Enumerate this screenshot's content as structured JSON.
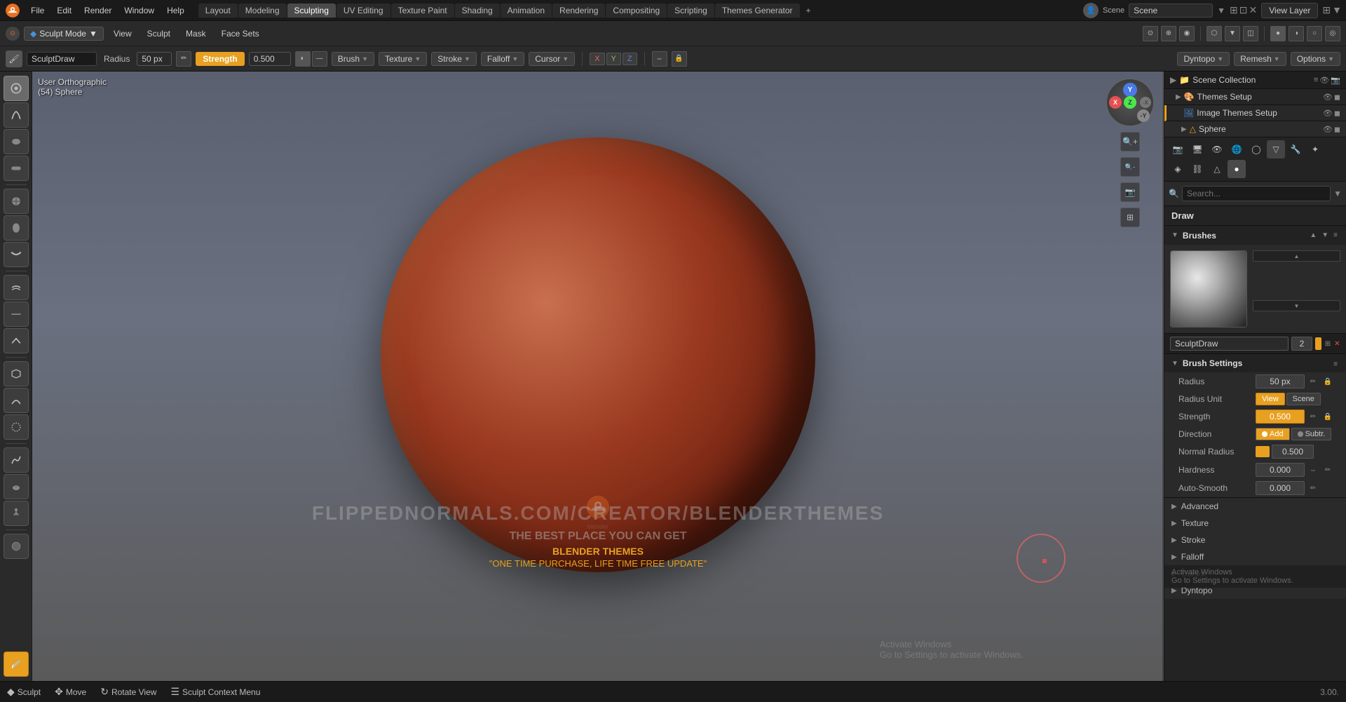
{
  "app": {
    "logo": "⊙",
    "menus": [
      "File",
      "Edit",
      "Render",
      "Window",
      "Help"
    ],
    "workspaces": [
      "Layout",
      "Modeling",
      "Sculpting",
      "UV Editing",
      "Texture Paint",
      "Shading",
      "Animation",
      "Rendering",
      "Compositing",
      "Scripting",
      "Themes Generator"
    ],
    "active_workspace": "Sculpting",
    "scene_name": "Scene",
    "view_layer": "View Layer"
  },
  "header": {
    "mode": "Sculpt Mode",
    "mode_icon": "▼",
    "view_btn": "View",
    "sculpt_btn": "Sculpt",
    "mask_btn": "Mask",
    "face_sets_btn": "Face Sets"
  },
  "sculpt_toolbar": {
    "brush_name": "SculptDraw",
    "radius_label": "Radius",
    "radius_value": "50 px",
    "strength_label": "Strength",
    "strength_value": "0.500",
    "brush_label": "Brush",
    "texture_label": "Texture",
    "stroke_label": "Stroke",
    "falloff_label": "Falloff",
    "cursor_label": "Cursor",
    "xyz": [
      "X",
      "Y",
      "Z"
    ],
    "dyntopo_label": "Dyntopo",
    "remesh_label": "Remesh",
    "options_label": "Options"
  },
  "viewport": {
    "view_name": "User Orthographic",
    "object_name": "(54) Sphere",
    "watermark_url": "FLIPPEDNORMALS.COM/CREATOR/BLENDERTHEMES",
    "watermark_tagline": "THE BEST PLACE YOU CAN GET",
    "watermark_sub": "BLENDER THEMES",
    "watermark_quote": "\"ONE TIME PURCHASE, LIFE TIME FREE UPDATE\"",
    "win_activate_line1": "Activate Windows",
    "win_activate_line2": "Go to Settings to activate Windows."
  },
  "right_panel": {
    "scene_collection_label": "Scene Collection",
    "themes_setup_label": "Themes Setup",
    "image_themes_setup_label": "Image Themes Setup",
    "sphere_label": "Sphere",
    "search_placeholder": "🔍",
    "draw_label": "Draw",
    "brushes_label": "Brushes",
    "brush_name": "SculptDraw",
    "brush_number": "2",
    "brush_settings_label": "Brush Settings",
    "radius_label": "Radius",
    "radius_value": "50 px",
    "radius_unit_label": "Radius Unit",
    "radius_view": "View",
    "radius_scene": "Scene",
    "strength_label": "Strength",
    "strength_value": "0.500",
    "direction_label": "Direction",
    "dir_add": "Add",
    "dir_subtract": "Subtr.",
    "normal_radius_label": "Normal Radius",
    "normal_radius_value": "0.500",
    "hardness_label": "Hardness",
    "hardness_value": "0.000",
    "auto_smooth_label": "Auto-Smooth",
    "auto_smooth_value": "0.000",
    "advanced_label": "Advanced",
    "texture_label": "Texture",
    "stroke_label": "Stroke",
    "falloff_label": "Falloff",
    "cursor_label_panel": "Cursor",
    "dyntopo_label_panel": "Dyntopo",
    "version": "3.00."
  },
  "status_bar": {
    "sculpt_label": "Sculpt",
    "move_label": "Move",
    "rotate_label": "Rotate View",
    "context_label": "Sculpt Context Menu"
  }
}
